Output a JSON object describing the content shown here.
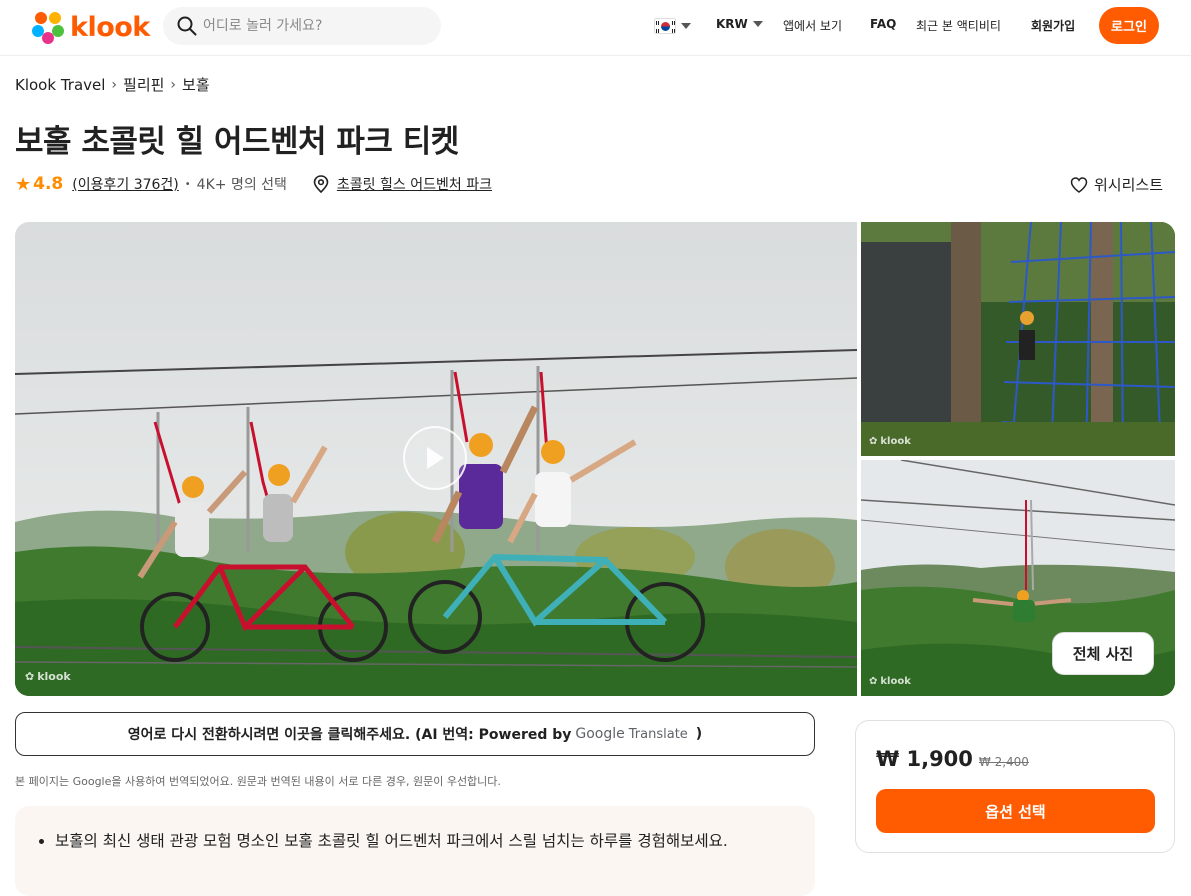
{
  "header": {
    "logo_text": "klook",
    "search_placeholder": "어디로 놀러 가세요?",
    "nav": {
      "language_flag": "KR",
      "currency": "KRW",
      "app_link": "앱에서 보기",
      "faq": "FAQ",
      "recently_viewed": "최근 본 액티비티",
      "signup": "회원가입",
      "login": "로그인"
    }
  },
  "breadcrumb": [
    "Klook Travel",
    "필리핀",
    "보홀"
  ],
  "title": "보홀 초콜릿 힐 어드벤처 파크 티켓",
  "meta": {
    "rating": "4.8",
    "reviews": "(이용후기 376건)",
    "booked": "4K+ 명의 선택",
    "location": "초콜릿 힐스 어드벤처 파크"
  },
  "wishlist_label": "위시리스트",
  "gallery": {
    "watermark": "klook",
    "all_photos_label": "전체 사진"
  },
  "translate": {
    "button_text": "영어로 다시 전환하시려면 이곳을 클릭해주세요. (AI 번역: Powered by",
    "google_word": "Google",
    "translate_word": "Translate",
    "close_paren": ")",
    "note": "본 페이지는 Google을 사용하여 번역되었어요. 원문과 번역된 내용이 서로 다른 경우, 원문이 우선합니다."
  },
  "highlights": [
    "보홀의 최신 생태 관광 모험 명소인 보홀 초콜릿 힐 어드벤처 파크에서 스릴 넘치는 하루를 경험해보세요."
  ],
  "booking": {
    "price": "₩ 1,900",
    "original_price": "₩ 2,400",
    "select_label": "옵션 선택"
  },
  "colors": {
    "brand": "#ff5b00",
    "rating": "#ff8c00"
  }
}
